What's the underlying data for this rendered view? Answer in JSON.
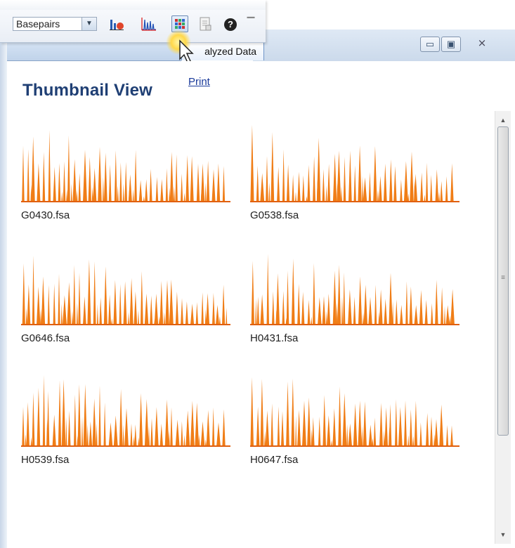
{
  "toolbar": {
    "units_select": {
      "value": "Basepairs",
      "dropdown_glyph": "▼"
    },
    "icons": [
      "bar-chart-icon",
      "peaks-icon",
      "grid-view-icon",
      "document-icon",
      "help-icon",
      "overflow-icon"
    ],
    "help_glyph": "?",
    "more_glyph": "▔"
  },
  "window": {
    "minimize_glyph": "▭",
    "maximize_glyph": "▣",
    "close_glyph": "⨯"
  },
  "tabs": {
    "active_label": "alyzed Data"
  },
  "content": {
    "title": "Thumbnail View",
    "print_link": "Print",
    "thumbnails": [
      {
        "label": "G0430.fsa"
      },
      {
        "label": "G0538.fsa"
      },
      {
        "label": "G0646.fsa"
      },
      {
        "label": "H0431.fsa"
      },
      {
        "label": "H0539.fsa"
      },
      {
        "label": "H0647.fsa"
      }
    ]
  },
  "scrollbar": {
    "up_glyph": "▲",
    "down_glyph": "▼",
    "grip_glyph": "≡"
  },
  "colors": {
    "trace": "#f07d16",
    "baseline": "#e06010",
    "title": "#1f3f74",
    "link": "#1a3a9a"
  }
}
